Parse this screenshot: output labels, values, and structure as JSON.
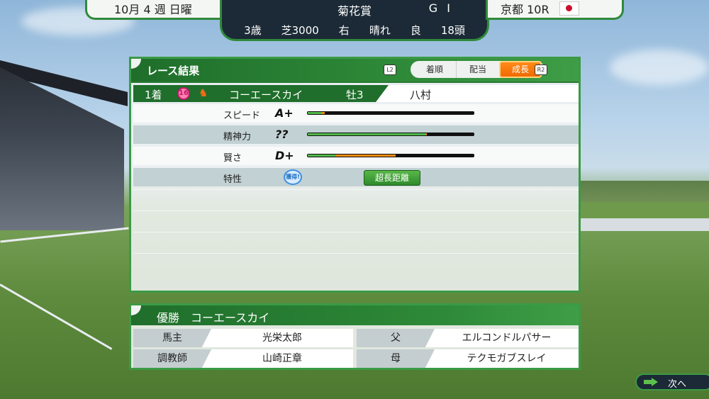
{
  "top": {
    "date": "10月 4 週 日曜",
    "race_name": "菊花賞",
    "grade": "G I",
    "info": [
      "3歳",
      "芝3000",
      "右",
      "晴れ",
      "良",
      "18頭"
    ],
    "venue": "京都 10R"
  },
  "result_panel": {
    "title": "レース結果",
    "l2": "L2",
    "r2": "R2",
    "tabs": [
      "着順",
      "配当",
      "成長"
    ],
    "active_tab": "成長",
    "winner": {
      "place": "1着",
      "gate_number": "16",
      "name": "コーエースカイ",
      "sex_age": "牡3",
      "jockey": "八村"
    },
    "stats": [
      {
        "label": "スピード",
        "grade": "A+",
        "green": 0.08,
        "orange": 0.02
      },
      {
        "label": "精神力",
        "grade": "??",
        "green": 0.71,
        "orange": 0.01
      },
      {
        "label": "賢さ",
        "grade": "D+",
        "green": 0.17,
        "orange": 0.36
      }
    ],
    "trait": {
      "label": "特性",
      "badge": "獲得!",
      "skill": "超長距離"
    }
  },
  "winner_panel": {
    "title": "優勝　コーエースカイ",
    "owner_label": "馬主",
    "owner": "光栄太郎",
    "trainer_label": "調教師",
    "trainer": "山崎正章",
    "sire_label": "父",
    "sire": "エルコンドルパサー",
    "dam_label": "母",
    "dam": "テクモガブスレイ"
  },
  "next_label": "次へ"
}
